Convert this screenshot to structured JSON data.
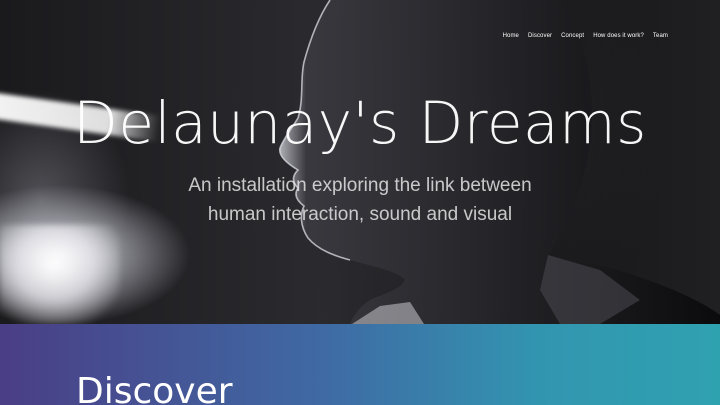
{
  "nav": {
    "items": [
      {
        "label": "Home"
      },
      {
        "label": "Discover"
      },
      {
        "label": "Concept"
      },
      {
        "label": "How does it work?"
      },
      {
        "label": "Team"
      }
    ]
  },
  "hero": {
    "title": "Delaunay's Dreams",
    "subtitle_line1": "An installation exploring the link between",
    "subtitle_line2": "human interaction, sound and visual"
  },
  "discover": {
    "heading": "Discover"
  },
  "colors": {
    "gradient_start": "#4a3e86",
    "gradient_end": "#2fa2b0",
    "text": "#ffffff"
  }
}
